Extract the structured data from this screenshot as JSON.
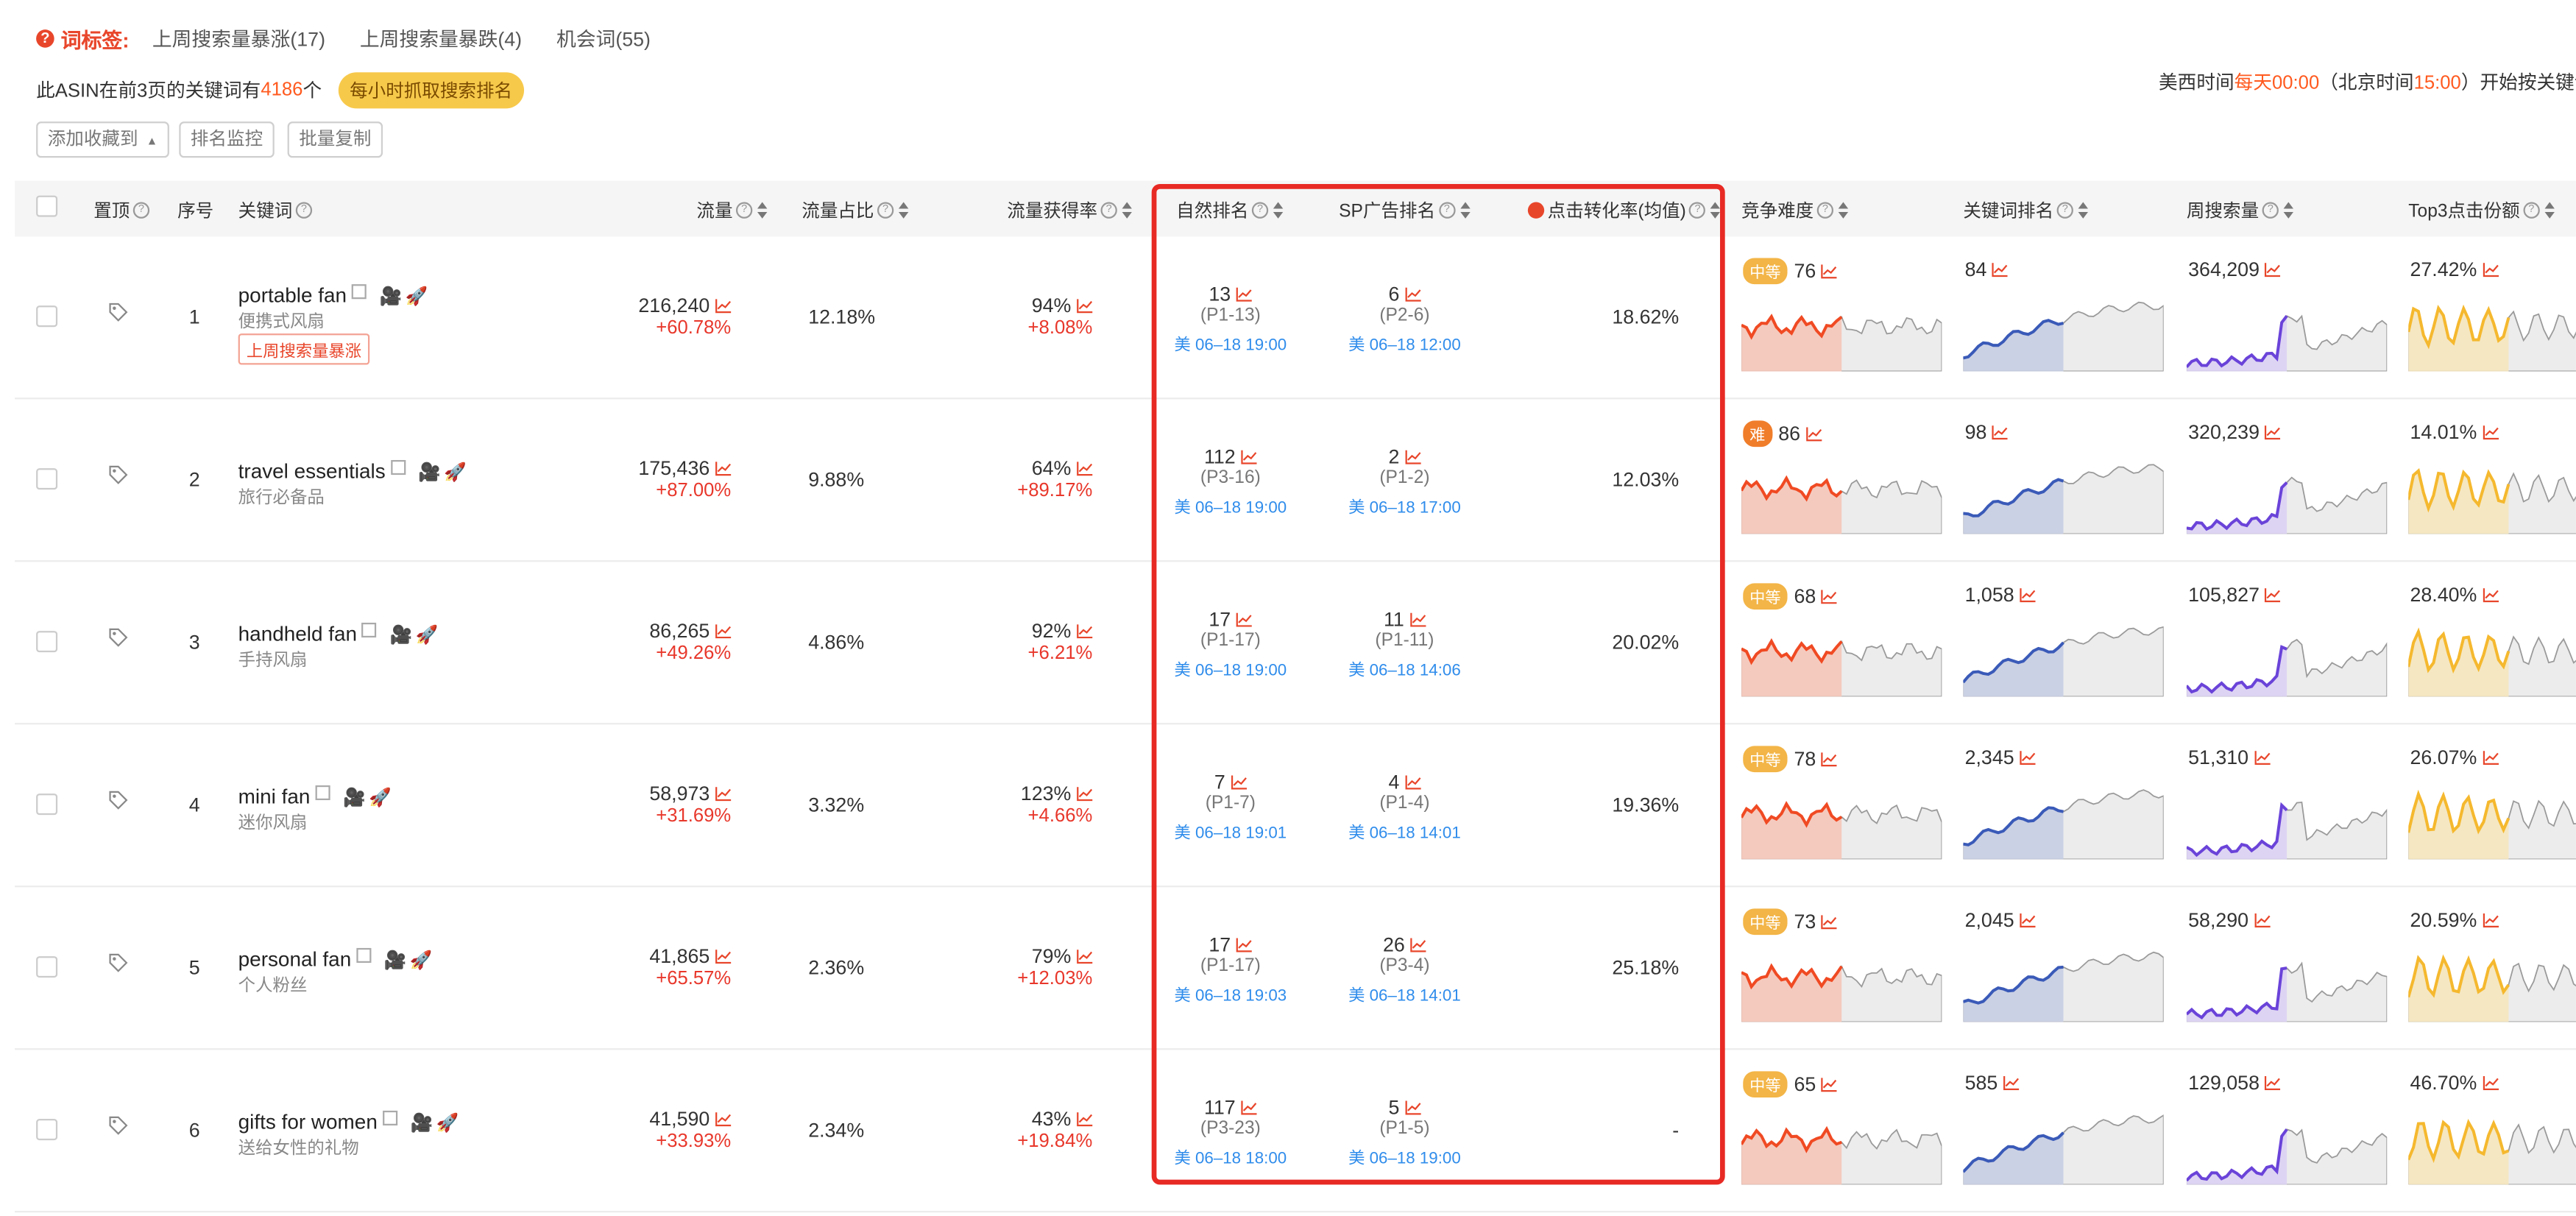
{
  "header_bar": {
    "tag_label": "词标签:",
    "tabs": [
      "上周搜索量暴涨(17)",
      "上周搜索量暴跌(4)",
      "机会词(55)"
    ],
    "count_prefix": "此ASIN在前3页的关键词有",
    "count_value": "4186",
    "count_suffix": "个",
    "hourly_badge": "每小时抓取搜索排名",
    "time_a": "美西时间",
    "time_b": "每天00:00",
    "time_c": "（北京时间",
    "time_d": "15:00",
    "time_e": "）开始按关键词"
  },
  "buttons": {
    "add_to_collection": "添加收藏到",
    "rank_monitor": "排名监控",
    "batch_copy": "批量复制"
  },
  "columns": {
    "pin": "置顶",
    "index": "序号",
    "keyword": "关键词",
    "traffic": "流量",
    "traffic_share": "流量占比",
    "traffic_gain": "流量获得率",
    "organic_rank": "自然排名",
    "sp_rank": "SP广告排名",
    "ctr": "点击转化率(均值)",
    "competition": "竞争难度",
    "keyword_rank": "关键词排名",
    "weekly_search": "周搜索量",
    "top3_click_share": "Top3点击份额"
  },
  "rows": [
    {
      "idx": "1",
      "kw": "portable fan",
      "cn": "便携式风扇",
      "badge": "上周搜索量暴涨",
      "traffic": "216,240",
      "traffic_chg": "+60.78%",
      "share": "12.18%",
      "gain": "94%",
      "gain_chg": "+8.08%",
      "org": "13",
      "org_pos": "(P1-13)",
      "org_time": "美 06–18 19:00",
      "sp": "6",
      "sp_pos": "(P2-6)",
      "sp_time": "美 06–18 12:00",
      "ctr": "18.62%",
      "diff_label": "中等",
      "diff_score": "76",
      "kw_rank": "84",
      "weekly": "364,209",
      "top3": "27.42%"
    },
    {
      "idx": "2",
      "kw": "travel essentials",
      "cn": "旅行必备品",
      "badge": "",
      "traffic": "175,436",
      "traffic_chg": "+87.00%",
      "share": "9.88%",
      "gain": "64%",
      "gain_chg": "+89.17%",
      "org": "112",
      "org_pos": "(P3-16)",
      "org_time": "美 06–18 19:00",
      "sp": "2",
      "sp_pos": "(P1-2)",
      "sp_time": "美 06–18 17:00",
      "ctr": "12.03%",
      "diff_label": "难",
      "diff_score": "86",
      "kw_rank": "98",
      "weekly": "320,239",
      "top3": "14.01%"
    },
    {
      "idx": "3",
      "kw": "handheld fan",
      "cn": "手持风扇",
      "badge": "",
      "traffic": "86,265",
      "traffic_chg": "+49.26%",
      "share": "4.86%",
      "gain": "92%",
      "gain_chg": "+6.21%",
      "org": "17",
      "org_pos": "(P1-17)",
      "org_time": "美 06–18 19:00",
      "sp": "11",
      "sp_pos": "(P1-11)",
      "sp_time": "美 06–18 14:06",
      "ctr": "20.02%",
      "diff_label": "中等",
      "diff_score": "68",
      "kw_rank": "1,058",
      "weekly": "105,827",
      "top3": "28.40%"
    },
    {
      "idx": "4",
      "kw": "mini fan",
      "cn": "迷你风扇",
      "badge": "",
      "traffic": "58,973",
      "traffic_chg": "+31.69%",
      "share": "3.32%",
      "gain": "123%",
      "gain_chg": "+4.66%",
      "org": "7",
      "org_pos": "(P1-7)",
      "org_time": "美 06–18 19:01",
      "sp": "4",
      "sp_pos": "(P1-4)",
      "sp_time": "美 06–18 14:01",
      "ctr": "19.36%",
      "diff_label": "中等",
      "diff_score": "78",
      "kw_rank": "2,345",
      "weekly": "51,310",
      "top3": "26.07%"
    },
    {
      "idx": "5",
      "kw": "personal fan",
      "cn": "个人粉丝",
      "badge": "",
      "traffic": "41,865",
      "traffic_chg": "+65.57%",
      "share": "2.36%",
      "gain": "79%",
      "gain_chg": "+12.03%",
      "org": "17",
      "org_pos": "(P1-17)",
      "org_time": "美 06–18 19:03",
      "sp": "26",
      "sp_pos": "(P3-4)",
      "sp_time": "美 06–18 14:01",
      "ctr": "25.18%",
      "diff_label": "中等",
      "diff_score": "73",
      "kw_rank": "2,045",
      "weekly": "58,290",
      "top3": "20.59%"
    },
    {
      "idx": "6",
      "kw": "gifts for women",
      "cn": "送给女性的礼物",
      "badge": "",
      "traffic": "41,590",
      "traffic_chg": "+33.93%",
      "share": "2.34%",
      "gain": "43%",
      "gain_chg": "+19.84%",
      "org": "117",
      "org_pos": "(P3-23)",
      "org_time": "美 06–18 18:00",
      "sp": "5",
      "sp_pos": "(P1-5)",
      "sp_time": "美 06–18 19:00",
      "ctr": "-",
      "diff_label": "中等",
      "diff_score": "65",
      "kw_rank": "585",
      "weekly": "129,058",
      "top3": "46.70%"
    }
  ],
  "colors": {
    "accent": "#ff5a1f",
    "highlight_frame": "#e82a24",
    "link_blue": "#2f8ceb",
    "medium_badge": "#f3b547",
    "hard_badge": "#f07d2a"
  },
  "icons": [
    "question-icon",
    "checkbox",
    "tag-icon",
    "copy-icon",
    "video-icon",
    "rocket-icon",
    "trend-icon",
    "sort-icon",
    "chevron-up-icon"
  ]
}
